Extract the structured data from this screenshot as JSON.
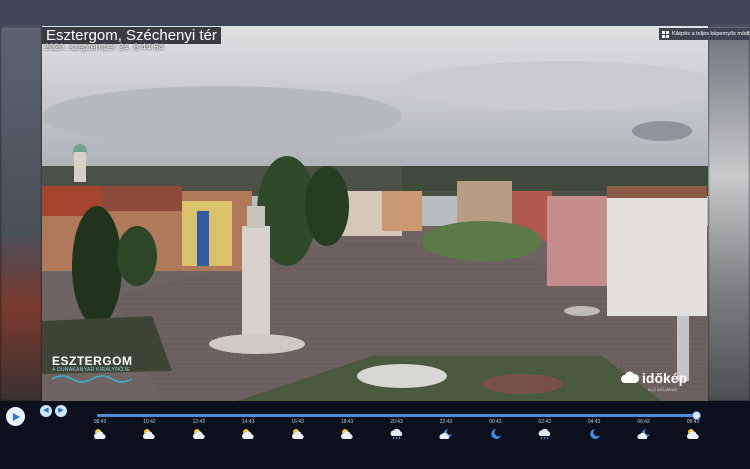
{
  "header": {
    "title": "Esztergom, Széchenyi tér",
    "timestamp": "2020. szeptember 24. 8:44:54",
    "fullscreen_label": "Kilépés a teljes képernyős módból"
  },
  "overlays": {
    "city_logo_main": "ESZTERGOM",
    "city_logo_sub": "A DUNAKANYAR KIRÁLYNŐJE",
    "brand_logo": "időkép",
    "brand_logo_sub": "ELŐ IDŐJÁRÁS"
  },
  "player": {
    "playback_progress": 1.0,
    "times": [
      "08:43",
      "10:42",
      "12:43",
      "14:43",
      "16:43",
      "18:43",
      "20:43",
      "22:43",
      "00:43",
      "02:43",
      "04:43",
      "06:42",
      "08:43"
    ],
    "weather_icons": [
      "partly-cloudy-icon",
      "partly-cloudy-icon",
      "partly-cloudy-icon",
      "partly-cloudy-icon",
      "partly-cloudy-icon",
      "partly-cloudy-icon",
      "rain-night-icon",
      "cloudy-night-icon",
      "moon-icon",
      "rain-night-icon",
      "moon-icon",
      "cloudy-night-icon",
      "partly-cloudy-icon"
    ]
  },
  "colors": {
    "accent": "#2a7bd0",
    "bar_background": "#0b101c"
  }
}
